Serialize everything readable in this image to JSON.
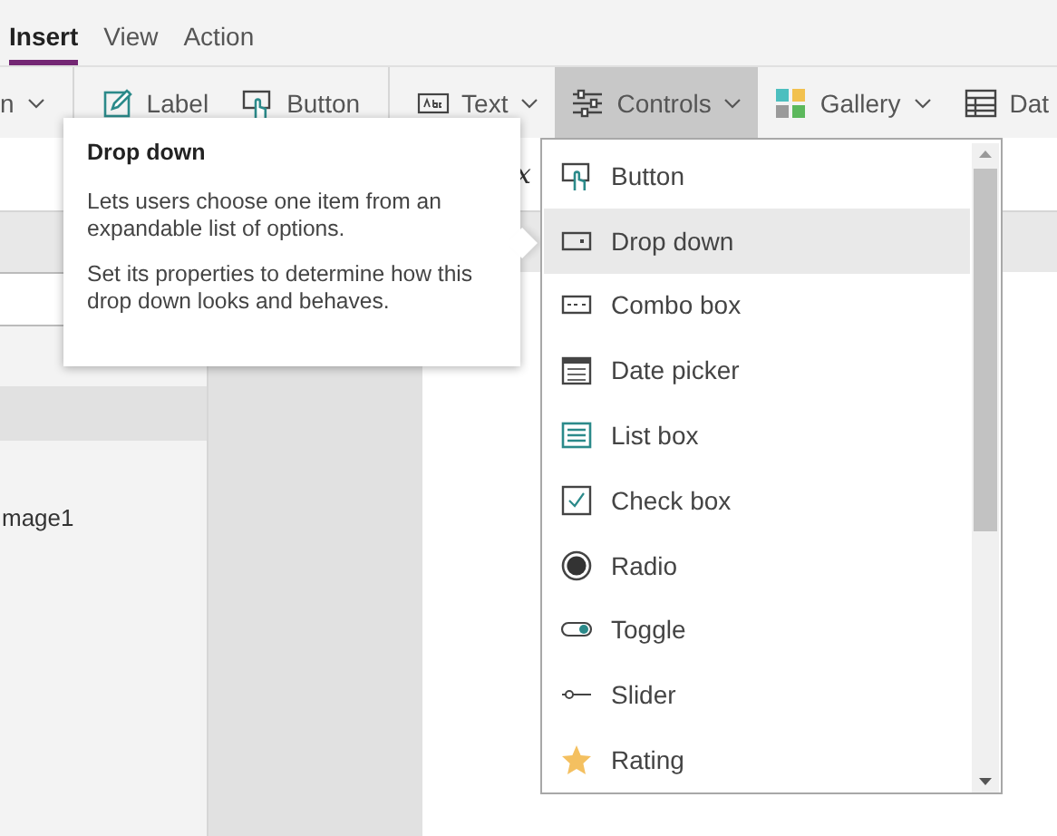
{
  "menu_tabs": [
    {
      "label": "Insert",
      "selected": true
    },
    {
      "label": "View",
      "selected": false
    },
    {
      "label": "Action",
      "selected": false
    }
  ],
  "ribbon_groups": [
    [
      {
        "label": "n",
        "kind": "none",
        "chevron": true,
        "selected": false
      }
    ],
    [
      {
        "label": "Label",
        "kind": "label",
        "chevron": false,
        "selected": false
      },
      {
        "label": "Button",
        "kind": "button",
        "chevron": false,
        "selected": false
      }
    ],
    [
      {
        "label": "Text",
        "kind": "text",
        "chevron": true,
        "selected": false
      },
      {
        "label": "Controls",
        "kind": "controls",
        "chevron": true,
        "selected": true
      },
      {
        "label": "Gallery",
        "kind": "gallery",
        "chevron": true,
        "selected": false
      },
      {
        "label": "Dat",
        "kind": "data",
        "chevron": false,
        "selected": false
      }
    ]
  ],
  "formula_bar": {
    "fx_fragment": "x"
  },
  "tree": {
    "items": [
      {
        "label": "mage1"
      }
    ]
  },
  "tooltip": {
    "title": "Drop down",
    "paragraphs": [
      "Lets users choose one item from an expandable list of options.",
      "Set its properties to determine how this drop down looks and behaves."
    ]
  },
  "controls_menu": {
    "items": [
      {
        "label": "Button",
        "kind": "button",
        "selected": false
      },
      {
        "label": "Drop down",
        "kind": "dropdown",
        "selected": true
      },
      {
        "label": "Combo box",
        "kind": "combo",
        "selected": false
      },
      {
        "label": "Date picker",
        "kind": "date",
        "selected": false
      },
      {
        "label": "List box",
        "kind": "listbox",
        "selected": false
      },
      {
        "label": "Check box",
        "kind": "checkbox",
        "selected": false
      },
      {
        "label": "Radio",
        "kind": "radio",
        "selected": false
      },
      {
        "label": "Toggle",
        "kind": "toggle",
        "selected": false
      },
      {
        "label": "Slider",
        "kind": "slider",
        "selected": false
      },
      {
        "label": "Rating",
        "kind": "rating",
        "selected": false
      }
    ]
  }
}
